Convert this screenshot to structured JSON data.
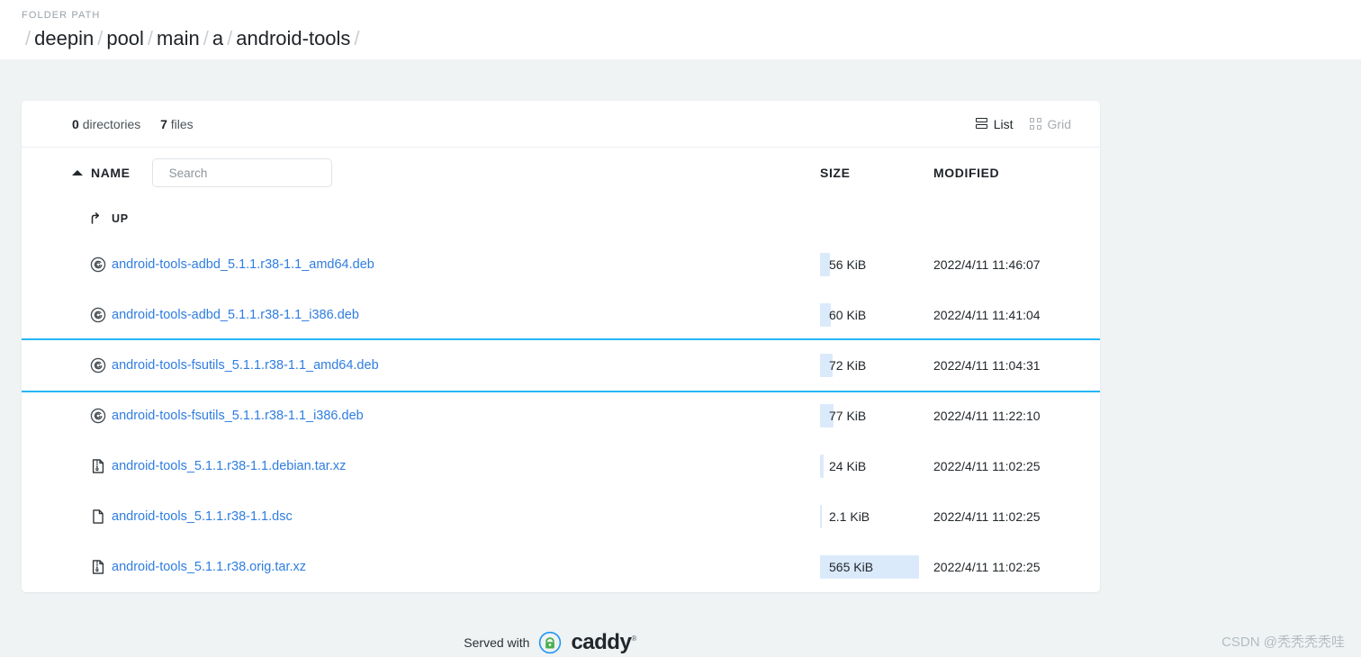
{
  "header": {
    "folder_path_label": "FOLDER PATH",
    "breadcrumb_root": "/",
    "breadcrumb_trailing": "/",
    "breadcrumb": [
      {
        "label": "deepin"
      },
      {
        "label": "pool"
      },
      {
        "label": "main"
      },
      {
        "label": "a"
      },
      {
        "label": "android-tools"
      }
    ]
  },
  "toolbar": {
    "dir_count": "0",
    "dir_label": "directories",
    "file_count": "7",
    "file_label": "files",
    "view_list_label": "List",
    "view_grid_label": "Grid",
    "active_view": "List"
  },
  "columns": {
    "name": "NAME",
    "size": "SIZE",
    "modified": "MODIFIED"
  },
  "search": {
    "placeholder": "Search",
    "value": ""
  },
  "up_row": {
    "label": "UP"
  },
  "files": [
    {
      "name": "android-tools-adbd_5.1.1.r38-1.1_amd64.deb",
      "icon": "package-icon",
      "size": "56 KiB",
      "size_pct": 10,
      "modified": "2022/4/11 11:46:07",
      "selected": false
    },
    {
      "name": "android-tools-adbd_5.1.1.r38-1.1_i386.deb",
      "icon": "package-icon",
      "size": "60 KiB",
      "size_pct": 11,
      "modified": "2022/4/11 11:41:04",
      "selected": false
    },
    {
      "name": "android-tools-fsutils_5.1.1.r38-1.1_amd64.deb",
      "icon": "package-icon",
      "size": "72 KiB",
      "size_pct": 13,
      "modified": "2022/4/11 11:04:31",
      "selected": true
    },
    {
      "name": "android-tools-fsutils_5.1.1.r38-1.1_i386.deb",
      "icon": "package-icon",
      "size": "77 KiB",
      "size_pct": 14,
      "modified": "2022/4/11 11:22:10",
      "selected": false
    },
    {
      "name": "android-tools_5.1.1.r38-1.1.debian.tar.xz",
      "icon": "archive-icon",
      "size": "24 KiB",
      "size_pct": 4,
      "modified": "2022/4/11 11:02:25",
      "selected": false
    },
    {
      "name": "android-tools_5.1.1.r38-1.1.dsc",
      "icon": "document-icon",
      "size": "2.1 KiB",
      "size_pct": 2,
      "modified": "2022/4/11 11:02:25",
      "selected": false
    },
    {
      "name": "android-tools_5.1.1.r38.orig.tar.xz",
      "icon": "archive-icon",
      "size": "565 KiB",
      "size_pct": 100,
      "modified": "2022/4/11 11:02:25",
      "selected": false
    }
  ],
  "footer": {
    "served_with": "Served with",
    "brand": "caddy",
    "registered_mark": "®"
  },
  "watermark": {
    "text": "CSDN @秃秃秃秃哇"
  },
  "colors": {
    "link": "#2f7de1",
    "selection_border": "#25b6f5",
    "size_bar": "#dbeafb",
    "page_bg": "#eff3f4",
    "caddy_green": "#52c41a"
  }
}
